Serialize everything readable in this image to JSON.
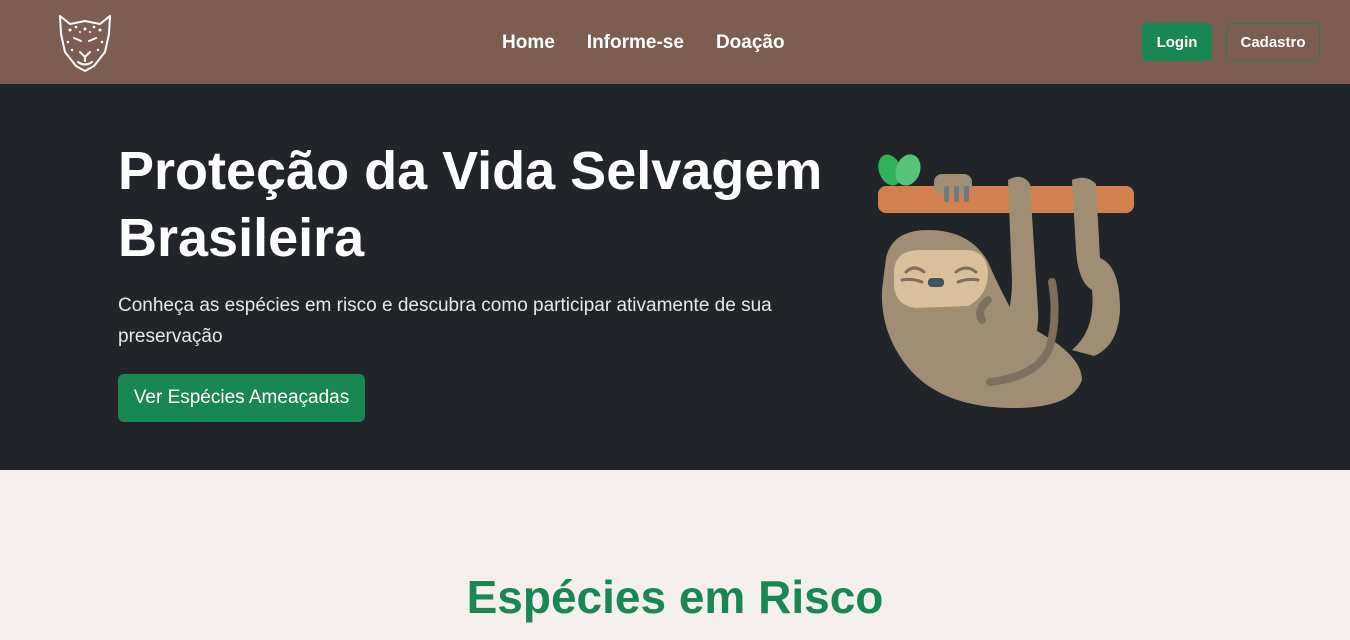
{
  "navbar": {
    "logo_icon": "jaguar-head-icon",
    "links": [
      {
        "label": "Home"
      },
      {
        "label": "Informe-se"
      },
      {
        "label": "Doação"
      }
    ],
    "login_label": "Login",
    "signup_label": "Cadastro"
  },
  "hero": {
    "title": "Proteção da Vida Selvagem Brasileira",
    "subtitle": "Conheça as espécies em risco e descubra como participar ativamente de sua preservação",
    "cta_label": "Ver Espécies Ameaçadas",
    "illustration_icon": "sloth-on-branch-icon"
  },
  "species_section": {
    "title": "Espécies em Risco"
  },
  "colors": {
    "navbar_bg": "#7e5d51",
    "hero_bg": "#212429",
    "accent_green": "#198754",
    "page_bg": "#f5f0ed"
  }
}
